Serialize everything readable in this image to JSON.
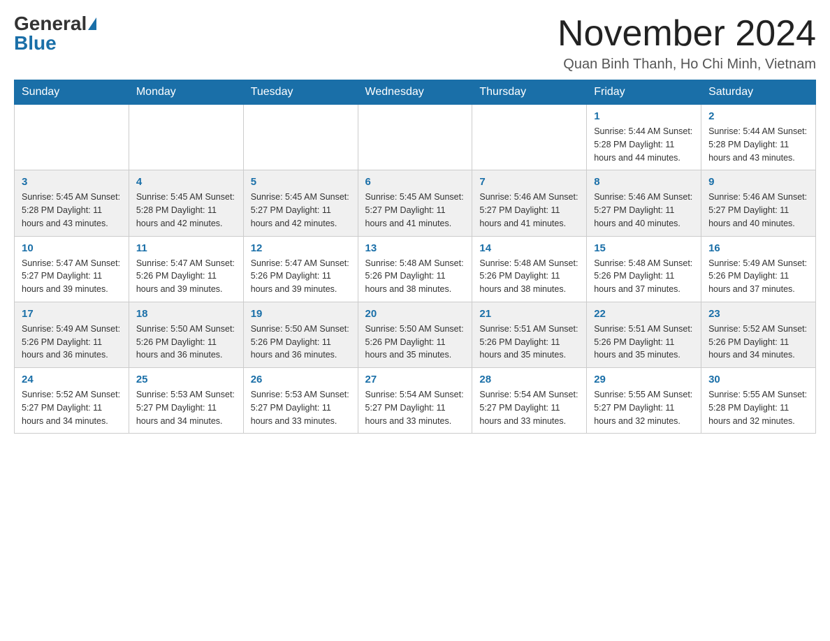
{
  "header": {
    "logo_general": "General",
    "logo_blue": "Blue",
    "month_title": "November 2024",
    "location": "Quan Binh Thanh, Ho Chi Minh, Vietnam"
  },
  "days_of_week": [
    "Sunday",
    "Monday",
    "Tuesday",
    "Wednesday",
    "Thursday",
    "Friday",
    "Saturday"
  ],
  "weeks": [
    {
      "days": [
        {
          "number": "",
          "info": ""
        },
        {
          "number": "",
          "info": ""
        },
        {
          "number": "",
          "info": ""
        },
        {
          "number": "",
          "info": ""
        },
        {
          "number": "",
          "info": ""
        },
        {
          "number": "1",
          "info": "Sunrise: 5:44 AM\nSunset: 5:28 PM\nDaylight: 11 hours and 44 minutes."
        },
        {
          "number": "2",
          "info": "Sunrise: 5:44 AM\nSunset: 5:28 PM\nDaylight: 11 hours and 43 minutes."
        }
      ]
    },
    {
      "days": [
        {
          "number": "3",
          "info": "Sunrise: 5:45 AM\nSunset: 5:28 PM\nDaylight: 11 hours and 43 minutes."
        },
        {
          "number": "4",
          "info": "Sunrise: 5:45 AM\nSunset: 5:28 PM\nDaylight: 11 hours and 42 minutes."
        },
        {
          "number": "5",
          "info": "Sunrise: 5:45 AM\nSunset: 5:27 PM\nDaylight: 11 hours and 42 minutes."
        },
        {
          "number": "6",
          "info": "Sunrise: 5:45 AM\nSunset: 5:27 PM\nDaylight: 11 hours and 41 minutes."
        },
        {
          "number": "7",
          "info": "Sunrise: 5:46 AM\nSunset: 5:27 PM\nDaylight: 11 hours and 41 minutes."
        },
        {
          "number": "8",
          "info": "Sunrise: 5:46 AM\nSunset: 5:27 PM\nDaylight: 11 hours and 40 minutes."
        },
        {
          "number": "9",
          "info": "Sunrise: 5:46 AM\nSunset: 5:27 PM\nDaylight: 11 hours and 40 minutes."
        }
      ]
    },
    {
      "days": [
        {
          "number": "10",
          "info": "Sunrise: 5:47 AM\nSunset: 5:27 PM\nDaylight: 11 hours and 39 minutes."
        },
        {
          "number": "11",
          "info": "Sunrise: 5:47 AM\nSunset: 5:26 PM\nDaylight: 11 hours and 39 minutes."
        },
        {
          "number": "12",
          "info": "Sunrise: 5:47 AM\nSunset: 5:26 PM\nDaylight: 11 hours and 39 minutes."
        },
        {
          "number": "13",
          "info": "Sunrise: 5:48 AM\nSunset: 5:26 PM\nDaylight: 11 hours and 38 minutes."
        },
        {
          "number": "14",
          "info": "Sunrise: 5:48 AM\nSunset: 5:26 PM\nDaylight: 11 hours and 38 minutes."
        },
        {
          "number": "15",
          "info": "Sunrise: 5:48 AM\nSunset: 5:26 PM\nDaylight: 11 hours and 37 minutes."
        },
        {
          "number": "16",
          "info": "Sunrise: 5:49 AM\nSunset: 5:26 PM\nDaylight: 11 hours and 37 minutes."
        }
      ]
    },
    {
      "days": [
        {
          "number": "17",
          "info": "Sunrise: 5:49 AM\nSunset: 5:26 PM\nDaylight: 11 hours and 36 minutes."
        },
        {
          "number": "18",
          "info": "Sunrise: 5:50 AM\nSunset: 5:26 PM\nDaylight: 11 hours and 36 minutes."
        },
        {
          "number": "19",
          "info": "Sunrise: 5:50 AM\nSunset: 5:26 PM\nDaylight: 11 hours and 36 minutes."
        },
        {
          "number": "20",
          "info": "Sunrise: 5:50 AM\nSunset: 5:26 PM\nDaylight: 11 hours and 35 minutes."
        },
        {
          "number": "21",
          "info": "Sunrise: 5:51 AM\nSunset: 5:26 PM\nDaylight: 11 hours and 35 minutes."
        },
        {
          "number": "22",
          "info": "Sunrise: 5:51 AM\nSunset: 5:26 PM\nDaylight: 11 hours and 35 minutes."
        },
        {
          "number": "23",
          "info": "Sunrise: 5:52 AM\nSunset: 5:26 PM\nDaylight: 11 hours and 34 minutes."
        }
      ]
    },
    {
      "days": [
        {
          "number": "24",
          "info": "Sunrise: 5:52 AM\nSunset: 5:27 PM\nDaylight: 11 hours and 34 minutes."
        },
        {
          "number": "25",
          "info": "Sunrise: 5:53 AM\nSunset: 5:27 PM\nDaylight: 11 hours and 34 minutes."
        },
        {
          "number": "26",
          "info": "Sunrise: 5:53 AM\nSunset: 5:27 PM\nDaylight: 11 hours and 33 minutes."
        },
        {
          "number": "27",
          "info": "Sunrise: 5:54 AM\nSunset: 5:27 PM\nDaylight: 11 hours and 33 minutes."
        },
        {
          "number": "28",
          "info": "Sunrise: 5:54 AM\nSunset: 5:27 PM\nDaylight: 11 hours and 33 minutes."
        },
        {
          "number": "29",
          "info": "Sunrise: 5:55 AM\nSunset: 5:27 PM\nDaylight: 11 hours and 32 minutes."
        },
        {
          "number": "30",
          "info": "Sunrise: 5:55 AM\nSunset: 5:28 PM\nDaylight: 11 hours and 32 minutes."
        }
      ]
    }
  ]
}
